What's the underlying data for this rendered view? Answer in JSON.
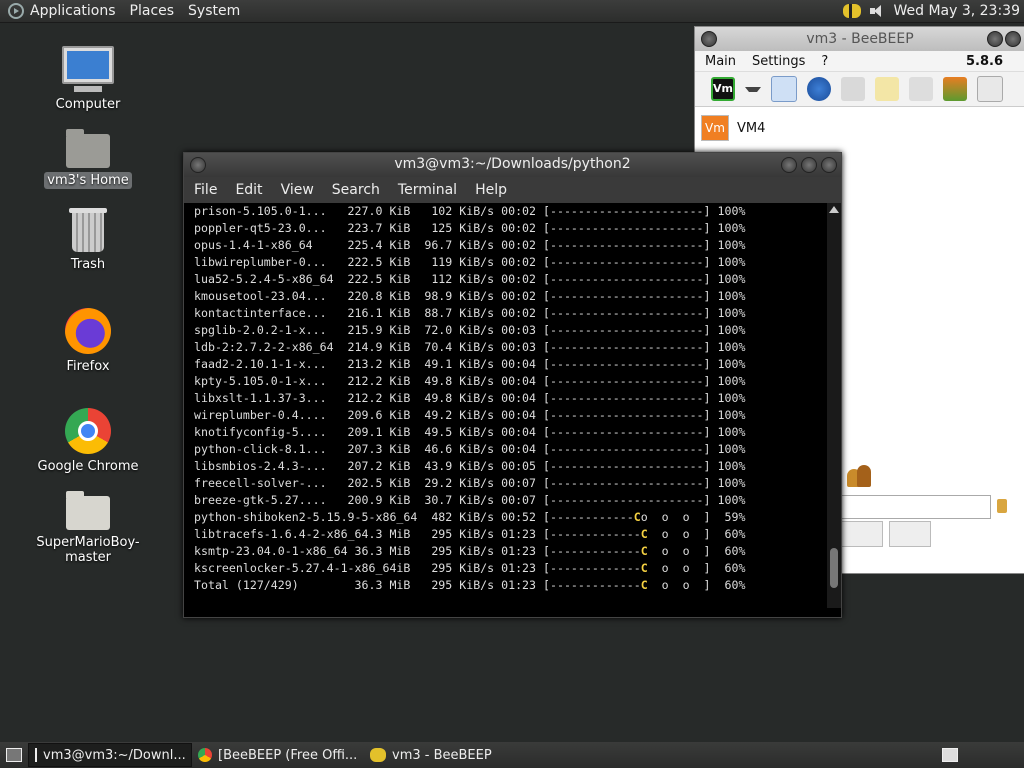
{
  "top_panel": {
    "menus": [
      "Applications",
      "Places",
      "System"
    ],
    "clock": "Wed May  3, 23:39"
  },
  "desktop": {
    "icons": [
      {
        "label": "Computer"
      },
      {
        "label": "vm3's Home"
      },
      {
        "label": "Trash"
      },
      {
        "label": "Firefox"
      },
      {
        "label": "Google Chrome"
      },
      {
        "label": "SuperMarioBoy-master"
      }
    ]
  },
  "beebeep": {
    "title": "vm3 - BeeBEEP",
    "menus": [
      "Main",
      "Settings",
      "?"
    ],
    "version": "5.8.6",
    "vm_button": "Vm",
    "user": {
      "badge": "Vm",
      "name": "VM4"
    }
  },
  "terminal": {
    "title": "vm3@vm3:~/Downloads/python2",
    "menus": [
      "File",
      "Edit",
      "View",
      "Search",
      "Terminal",
      "Help"
    ],
    "lines": [
      {
        "text": "prison-5.105.0-1...   227.0 KiB   102 KiB/s 00:02 [----------------------] 100%"
      },
      {
        "text": "poppler-qt5-23.0...   223.7 KiB   125 KiB/s 00:02 [----------------------] 100%"
      },
      {
        "text": "opus-1.4-1-x86_64     225.4 KiB  96.7 KiB/s 00:02 [----------------------] 100%"
      },
      {
        "text": "libwireplumber-0...   222.5 KiB   119 KiB/s 00:02 [----------------------] 100%"
      },
      {
        "text": "lua52-5.2.4-5-x86_64  222.5 KiB   112 KiB/s 00:02 [----------------------] 100%"
      },
      {
        "text": "kmousetool-23.04...   220.8 KiB  98.9 KiB/s 00:02 [----------------------] 100%"
      },
      {
        "text": "kontactinterface...   216.1 KiB  88.7 KiB/s 00:02 [----------------------] 100%"
      },
      {
        "text": "spglib-2.0.2-1-x...   215.9 KiB  72.0 KiB/s 00:03 [----------------------] 100%"
      },
      {
        "text": "ldb-2:2.7.2-2-x86_64  214.9 KiB  70.4 KiB/s 00:03 [----------------------] 100%"
      },
      {
        "text": "faad2-2.10.1-1-x...   213.2 KiB  49.1 KiB/s 00:04 [----------------------] 100%"
      },
      {
        "text": "kpty-5.105.0-1-x...   212.2 KiB  49.8 KiB/s 00:04 [----------------------] 100%"
      },
      {
        "text": "libxslt-1.1.37-3...   212.2 KiB  49.8 KiB/s 00:04 [----------------------] 100%"
      },
      {
        "text": "wireplumber-0.4....   209.6 KiB  49.2 KiB/s 00:04 [----------------------] 100%"
      },
      {
        "text": "knotifyconfig-5....   209.1 KiB  49.5 KiB/s 00:04 [----------------------] 100%"
      },
      {
        "text": "python-click-8.1...   207.3 KiB  46.6 KiB/s 00:04 [----------------------] 100%"
      },
      {
        "text": "libsmbios-2.4.3-...   207.2 KiB  43.9 KiB/s 00:05 [----------------------] 100%"
      },
      {
        "text": "freecell-solver-...   202.5 KiB  29.2 KiB/s 00:07 [----------------------] 100%"
      },
      {
        "text": "breeze-gtk-5.27....   200.9 KiB  30.7 KiB/s 00:07 [----------------------] 100%"
      },
      {
        "pre": "python-shiboken2-5.15.9-5-x86_64  482 KiB/s 00:52 [------------",
        "pac": "C",
        "post": "o  o  o  ]  59%"
      },
      {
        "pre": "libtracefs-1.6.4-2-x86_64.3 MiB   295 KiB/s 01:23 [-------------",
        "pac": "C",
        "post": "  o  o  ]  60%"
      },
      {
        "pre": "ksmtp-23.04.0-1-x86_64 36.3 MiB   295 KiB/s 01:23 [-------------",
        "pac": "C",
        "post": "  o  o  ]  60%"
      },
      {
        "pre": "kscreenlocker-5.27.4-1-x86_64iB   295 KiB/s 01:23 [-------------",
        "pac": "C",
        "post": "  o  o  ]  60%"
      },
      {
        "pre": "Total (127/429)        36.3 MiB   295 KiB/s 01:23 [-------------",
        "pac": "C",
        "post": "  o  o  ]  60%"
      }
    ]
  },
  "taskbar": {
    "items": [
      "vm3@vm3:~/Downl...",
      "[BeeBEEP (Free Offi...",
      "vm3 - BeeBEEP"
    ]
  }
}
